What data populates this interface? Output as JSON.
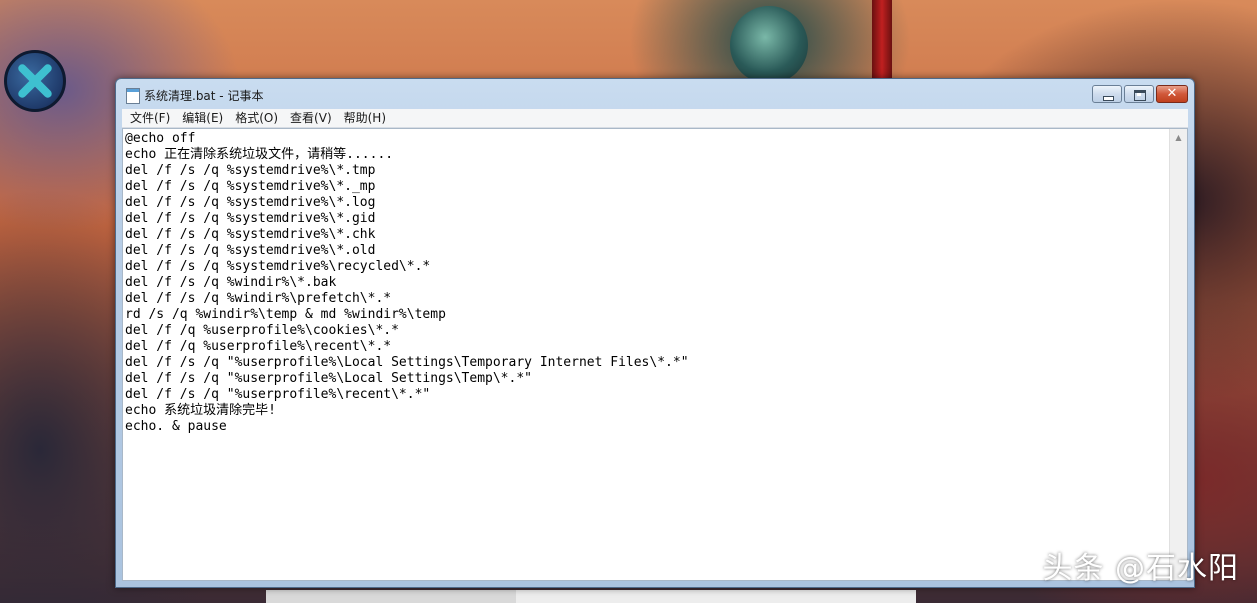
{
  "window": {
    "title": "系统清理.bat - 记事本",
    "close_glyph": "✕"
  },
  "menu": {
    "items": [
      {
        "label": "文件(F)"
      },
      {
        "label": "编辑(E)"
      },
      {
        "label": "格式(O)"
      },
      {
        "label": "查看(V)"
      },
      {
        "label": "帮助(H)"
      }
    ]
  },
  "editor": {
    "lines": [
      "@echo off",
      "echo 正在清除系统垃圾文件，请稍等......",
      "del /f /s /q %systemdrive%\\*.tmp",
      "del /f /s /q %systemdrive%\\*._mp",
      "del /f /s /q %systemdrive%\\*.log",
      "del /f /s /q %systemdrive%\\*.gid",
      "del /f /s /q %systemdrive%\\*.chk",
      "del /f /s /q %systemdrive%\\*.old",
      "del /f /s /q %systemdrive%\\recycled\\*.*",
      "del /f /s /q %windir%\\*.bak",
      "del /f /s /q %windir%\\prefetch\\*.*",
      "rd /s /q %windir%\\temp & md %windir%\\temp",
      "del /f /q %userprofile%\\cookies\\*.*",
      "del /f /q %userprofile%\\recent\\*.*",
      "del /f /s /q \"%userprofile%\\Local Settings\\Temporary Internet Files\\*.*\"",
      "del /f /s /q \"%userprofile%\\Local Settings\\Temp\\*.*\"",
      "del /f /s /q \"%userprofile%\\recent\\*.*\"",
      "echo 系统垃圾清除完毕!",
      "echo. & pause"
    ],
    "scroll_up_glyph": "▲"
  },
  "watermark": "头条 @石水阳",
  "colors": {
    "close_button": "#c0401e",
    "titlebar": "#b7cde6",
    "editor_bg": "#ffffff"
  }
}
